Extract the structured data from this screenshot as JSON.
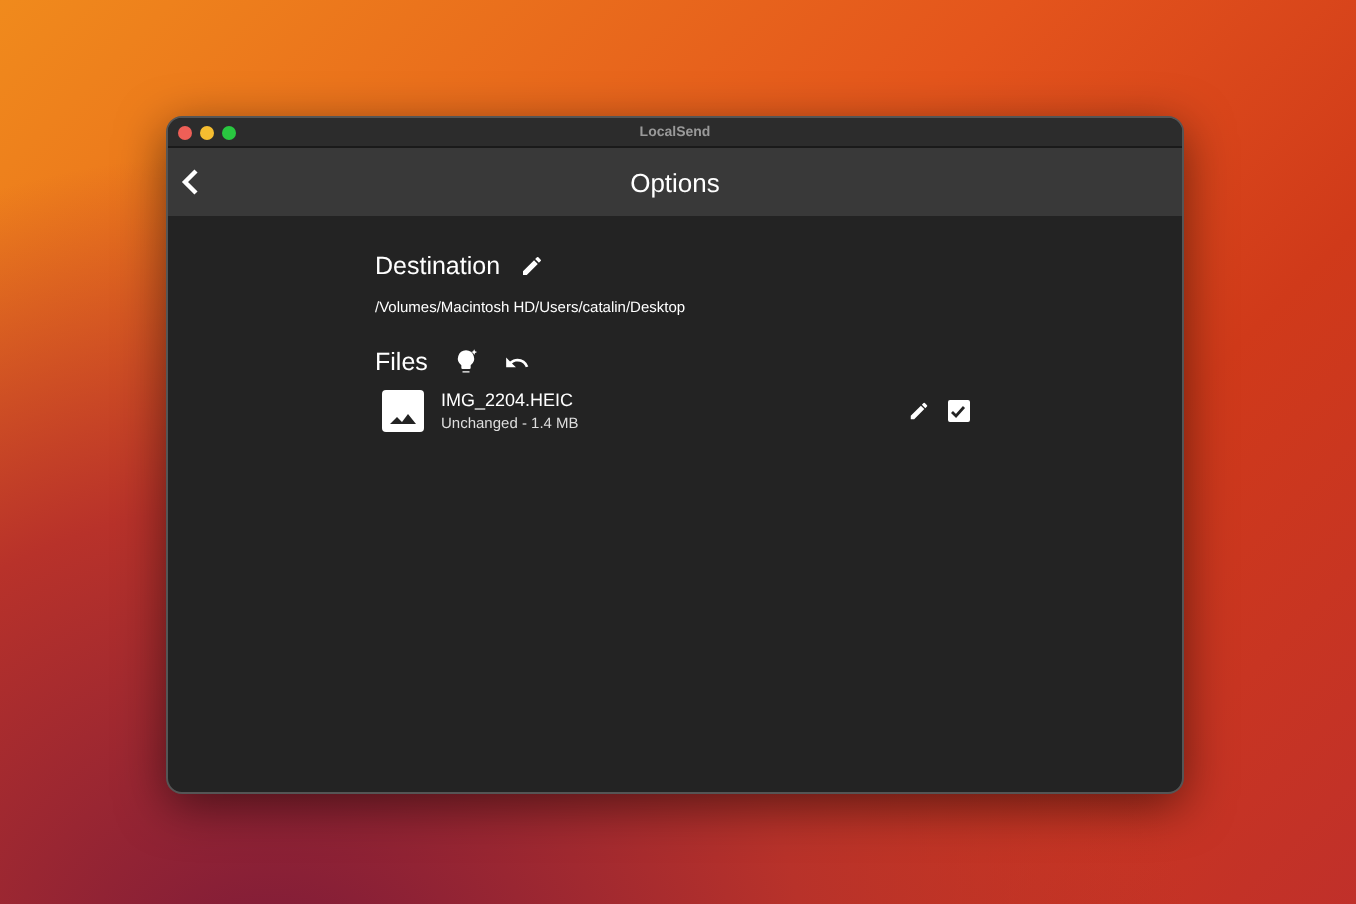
{
  "window": {
    "title": "LocalSend"
  },
  "app_bar": {
    "title": "Options"
  },
  "destination": {
    "label": "Destination",
    "path": "/Volumes/Macintosh HD/Users/catalin/Desktop"
  },
  "files": {
    "label": "Files",
    "items": [
      {
        "name": "IMG_2204.HEIC",
        "status": "Unchanged - 1.4 MB",
        "checked": true
      }
    ]
  }
}
